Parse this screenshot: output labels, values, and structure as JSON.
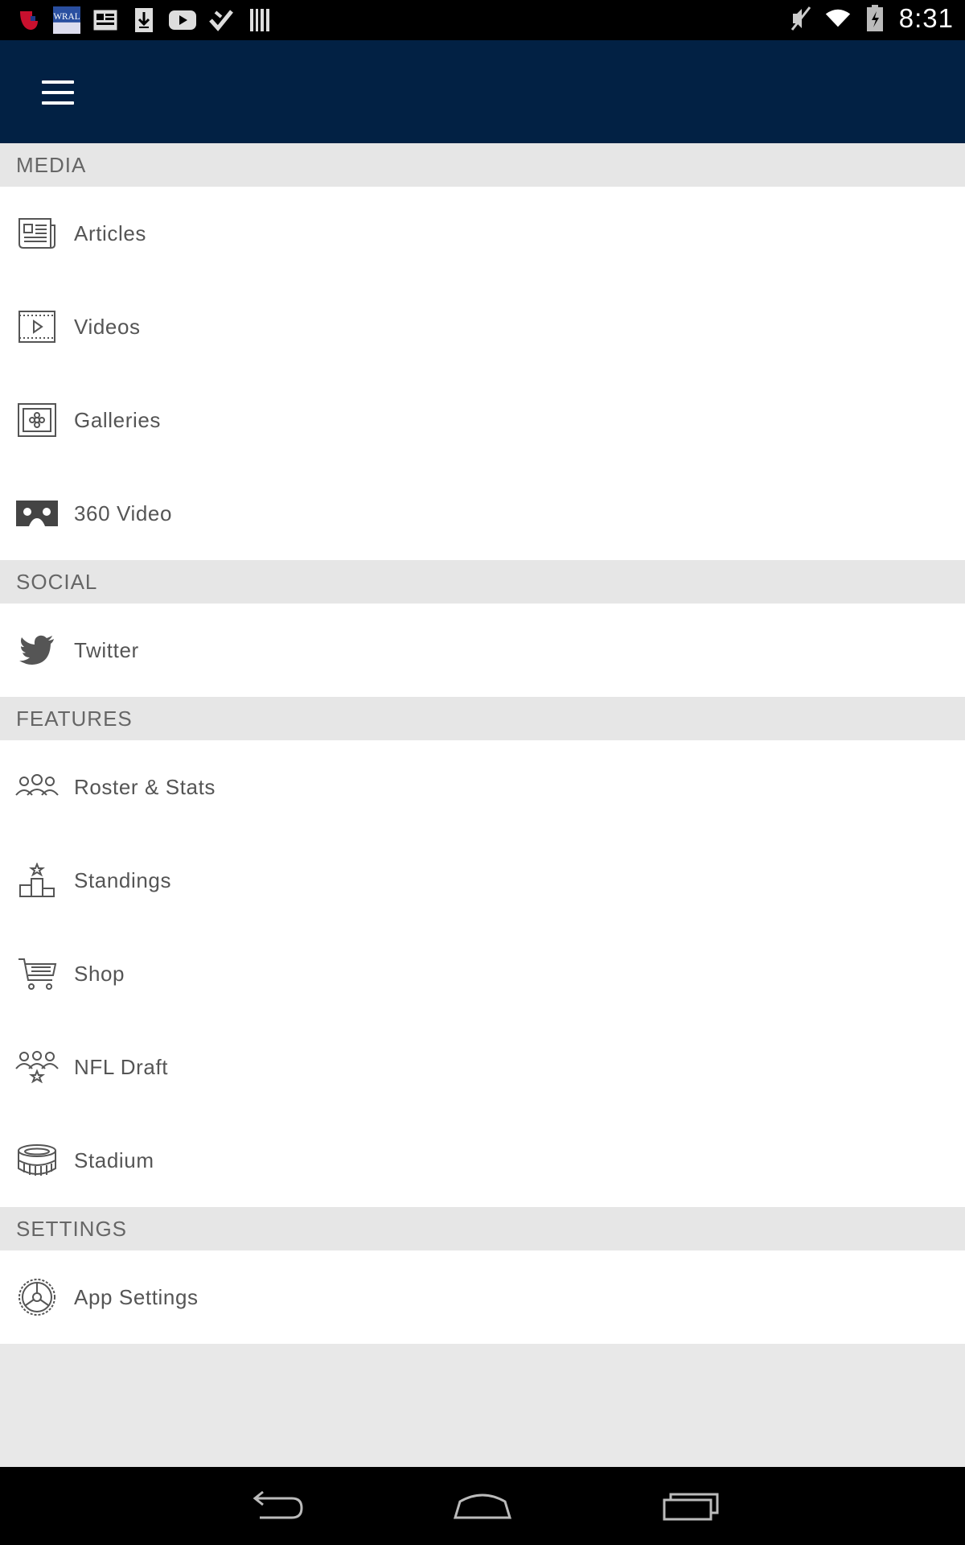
{
  "status_bar": {
    "time": "8:31",
    "left_icons": [
      "app-icon",
      "weather-icon",
      "news-icon",
      "download-icon",
      "youtube-icon",
      "check-icon",
      "barcode-icon"
    ],
    "right_icons": [
      "mute-icon",
      "wifi-icon",
      "battery-icon"
    ]
  },
  "app_bar": {
    "menu_icon": "hamburger-icon"
  },
  "drawer": {
    "sections": [
      {
        "title": "MEDIA",
        "items": [
          {
            "label": "Articles",
            "icon": "article-icon"
          },
          {
            "label": "Videos",
            "icon": "video-icon"
          },
          {
            "label": "Galleries",
            "icon": "gallery-icon"
          },
          {
            "label": "360 Video",
            "icon": "vr-headset-icon"
          }
        ]
      },
      {
        "title": "SOCIAL",
        "items": [
          {
            "label": "Twitter",
            "icon": "twitter-icon"
          }
        ]
      },
      {
        "title": "FEATURES",
        "items": [
          {
            "label": "Roster & Stats",
            "icon": "roster-icon"
          },
          {
            "label": "Standings",
            "icon": "podium-icon"
          },
          {
            "label": "Shop",
            "icon": "cart-icon"
          },
          {
            "label": "NFL Draft",
            "icon": "draft-icon"
          },
          {
            "label": "Stadium",
            "icon": "stadium-icon"
          }
        ]
      },
      {
        "title": "SETTINGS",
        "items": [
          {
            "label": "App Settings",
            "icon": "settings-icon"
          }
        ]
      }
    ]
  },
  "nav_bar": {
    "buttons": [
      "back-icon",
      "home-icon",
      "recents-icon"
    ]
  }
}
